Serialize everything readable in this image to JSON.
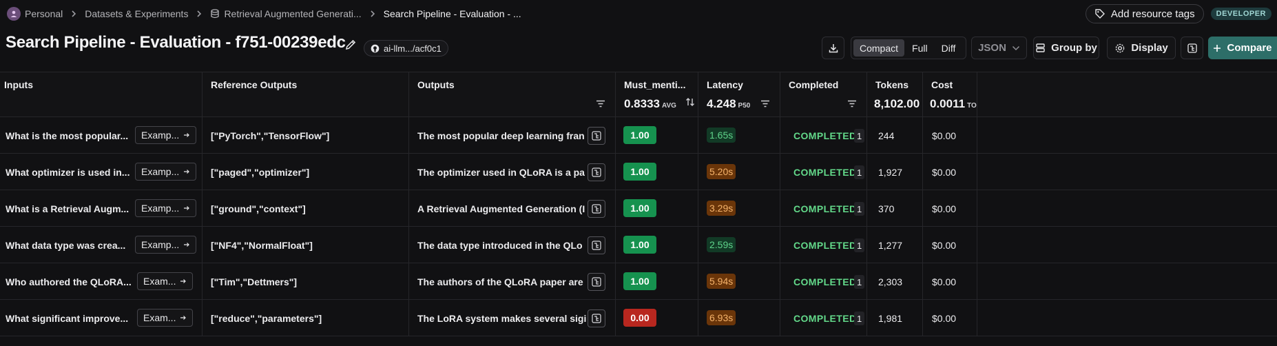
{
  "breadcrumb": {
    "items": [
      "Personal",
      "Datasets & Experiments",
      "Retrieval Augmented Generati...",
      "Search Pipeline - Evaluation - ..."
    ]
  },
  "header": {
    "add_tags_label": "Add resource tags",
    "badge": "DEVELOPER",
    "title": "Search Pipeline - Evaluation - f751-00239edc",
    "repo": "ai-llm.../acf0c1",
    "view_modes": [
      "Compact",
      "Full",
      "Diff"
    ],
    "active_view": "Compact",
    "format": "JSON",
    "group_by_label": "Group by",
    "display_label": "Display",
    "compare_label": "Compare"
  },
  "columns": {
    "inputs": "Inputs",
    "reference": "Reference Outputs",
    "outputs": "Outputs",
    "must_mention": "Must_menti...",
    "must_mention_stat": "0.8333",
    "must_mention_stat_label": "AVG",
    "latency": "Latency",
    "latency_stat": "4.248",
    "latency_stat_label": "P50",
    "completed": "Completed",
    "tokens": "Tokens",
    "tokens_stat": "8,102.00",
    "cost": "Cost",
    "cost_stat": "0.0011",
    "cost_stat_label": "TO"
  },
  "rows": [
    {
      "input": "What is the most popular...",
      "example": "Examp...",
      "reference": "[\"PyTorch\",\"TensorFlow\"]",
      "output": "The most popular deep learning fran",
      "score": "1.00",
      "latency": "1.65s",
      "status": "COMPLETED",
      "count": "1",
      "tokens": "244",
      "cost": "$0.00"
    },
    {
      "input": "What optimizer is used in...",
      "example": "Examp...",
      "reference": "[\"paged\",\"optimizer\"]",
      "output": "The optimizer used in QLoRA is a pa",
      "score": "1.00",
      "latency": "5.20s",
      "status": "COMPLETED",
      "count": "1",
      "tokens": "1,927",
      "cost": "$0.00"
    },
    {
      "input": "What is a Retrieval Augm...",
      "example": "Examp...",
      "reference": "[\"ground\",\"context\"]",
      "output": "A Retrieval Augmented Generation (I",
      "score": "1.00",
      "latency": "3.29s",
      "status": "COMPLETED",
      "count": "1",
      "tokens": "370",
      "cost": "$0.00"
    },
    {
      "input": "What data type was crea...",
      "example": "Examp...",
      "reference": "[\"NF4\",\"NormalFloat\"]",
      "output": "The data type introduced in the QLo",
      "score": "1.00",
      "latency": "2.59s",
      "status": "COMPLETED",
      "count": "1",
      "tokens": "1,277",
      "cost": "$0.00"
    },
    {
      "input": "Who authored the QLoRA...",
      "example": "Exam...",
      "reference": "[\"Tim\",\"Dettmers\"]",
      "output": "The authors of the QLoRA paper are",
      "score": "1.00",
      "latency": "5.94s",
      "status": "COMPLETED",
      "count": "1",
      "tokens": "2,303",
      "cost": "$0.00"
    },
    {
      "input": "What significant improve...",
      "example": "Exam...",
      "reference": "[\"reduce\",\"parameters\"]",
      "output": "The LoRA system makes several sigi",
      "score": "0.00",
      "latency": "6.93s",
      "status": "COMPLETED",
      "count": "1",
      "tokens": "1,981",
      "cost": "$0.00"
    }
  ],
  "colors": {
    "score_pass": "#16924f",
    "score_fail": "#b8271f",
    "latency_fast_bg": "#123a26",
    "latency_fast_fg": "#5fd38a",
    "latency_slow_bg": "#6a3509",
    "latency_slow_fg": "#f6b36a",
    "accent": "#2d6e68"
  }
}
